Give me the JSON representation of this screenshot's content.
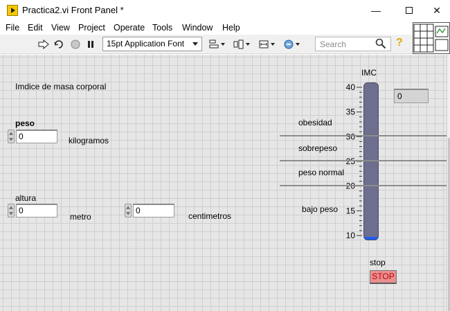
{
  "window": {
    "title": "Practica2.vi Front Panel *",
    "controls": {
      "minimize": "—",
      "close": "✕"
    }
  },
  "menu": {
    "items": [
      "File",
      "Edit",
      "View",
      "Project",
      "Operate",
      "Tools",
      "Window",
      "Help"
    ]
  },
  "toolbar": {
    "icons": [
      "run-arrow-icon",
      "run-continuously-icon",
      "abort-icon",
      "pause-icon",
      "align-icon",
      "distribute-icon",
      "resize-icon",
      "reorder-icon"
    ],
    "font": "15pt Application Font",
    "search_placeholder": "Search",
    "help": "?"
  },
  "panel": {
    "heading": "Imdice de masa corporal",
    "peso": {
      "label": "peso",
      "value": "0",
      "unit": "kilogramos"
    },
    "altura": {
      "label": "altura",
      "value": "0",
      "unit": "metro"
    },
    "cm": {
      "value": "0",
      "unit": "centimetros"
    },
    "imc": {
      "label": "IMC",
      "value": 0,
      "display": "0",
      "scale_min": 10,
      "scale_max": 40,
      "ticks": [
        "40",
        "35",
        "30",
        "25",
        "20",
        "15",
        "10"
      ],
      "fill_color": "#1e5ef0"
    },
    "ranges": [
      "obesidad",
      "sobrepeso",
      "peso normal",
      "bajo peso"
    ],
    "stop": {
      "label": "stop",
      "button": "STOP"
    }
  }
}
